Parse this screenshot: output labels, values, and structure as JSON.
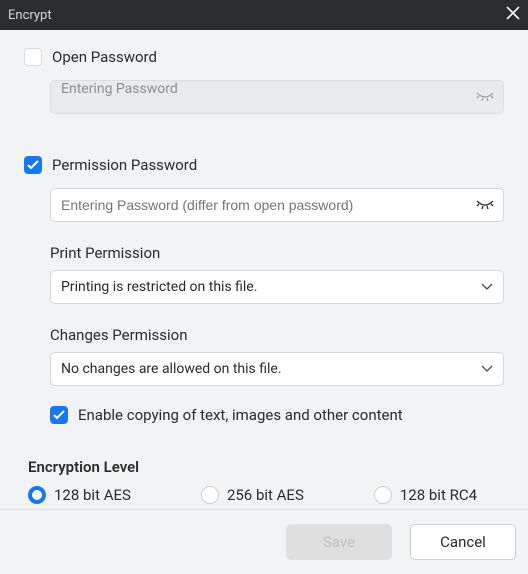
{
  "titlebar": {
    "title": "Encrypt"
  },
  "open_password": {
    "label": "Open Password",
    "checked": false,
    "placeholder": "Entering Password"
  },
  "permission_password": {
    "label": "Permission Password",
    "checked": true,
    "placeholder": "Entering Password (differ from open password)"
  },
  "print_permission": {
    "label": "Print Permission",
    "value": "Printing is restricted on this file."
  },
  "changes_permission": {
    "label": "Changes Permission",
    "value": "No changes are allowed on this file."
  },
  "enable_copy": {
    "checked": true,
    "label": "Enable copying of text, images and other content"
  },
  "encryption_level": {
    "title": "Encryption Level",
    "options": {
      "aes128": "128 bit AES",
      "aes256": "256 bit AES",
      "rc4128": "128 bit RC4"
    },
    "selected": "aes128"
  },
  "footer": {
    "save": "Save",
    "cancel": "Cancel"
  }
}
